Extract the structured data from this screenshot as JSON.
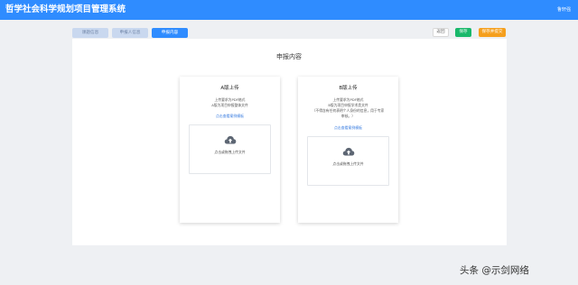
{
  "header": {
    "title": "哲学社会科学规划项目管理系统",
    "user_label": "鲁轩强"
  },
  "tabs": [
    {
      "label": "课题信息",
      "active": false
    },
    {
      "label": "申报人信息",
      "active": false
    },
    {
      "label": "申报内容",
      "active": true
    }
  ],
  "actions": {
    "return_label": "返回",
    "save_label": "保存",
    "save_submit_label": "保存并提交"
  },
  "section": {
    "title": "申报内容"
  },
  "cards": [
    {
      "title": "A版上传",
      "notes": [
        "上传要求为PDF格式",
        "A版为项目申报整体文件"
      ],
      "template_link": "点击查看案例模板",
      "upload_text": "点击或拖拽上传文件"
    },
    {
      "title": "B版上传",
      "notes": [
        "上传要求为PDF格式",
        "B版为项目申报学术类文件",
        "（不得含有任何表明个人身份的信息，用于专家",
        "审核。）"
      ],
      "template_link": "点击查看案例模板",
      "upload_text": "点击或拖拽上传文件"
    }
  ],
  "watermark": "头条 @示剑网络",
  "colors": {
    "primary": "#2f8cff",
    "save": "#19b86b",
    "submit": "#f59f1d",
    "link": "#3a7de0"
  }
}
